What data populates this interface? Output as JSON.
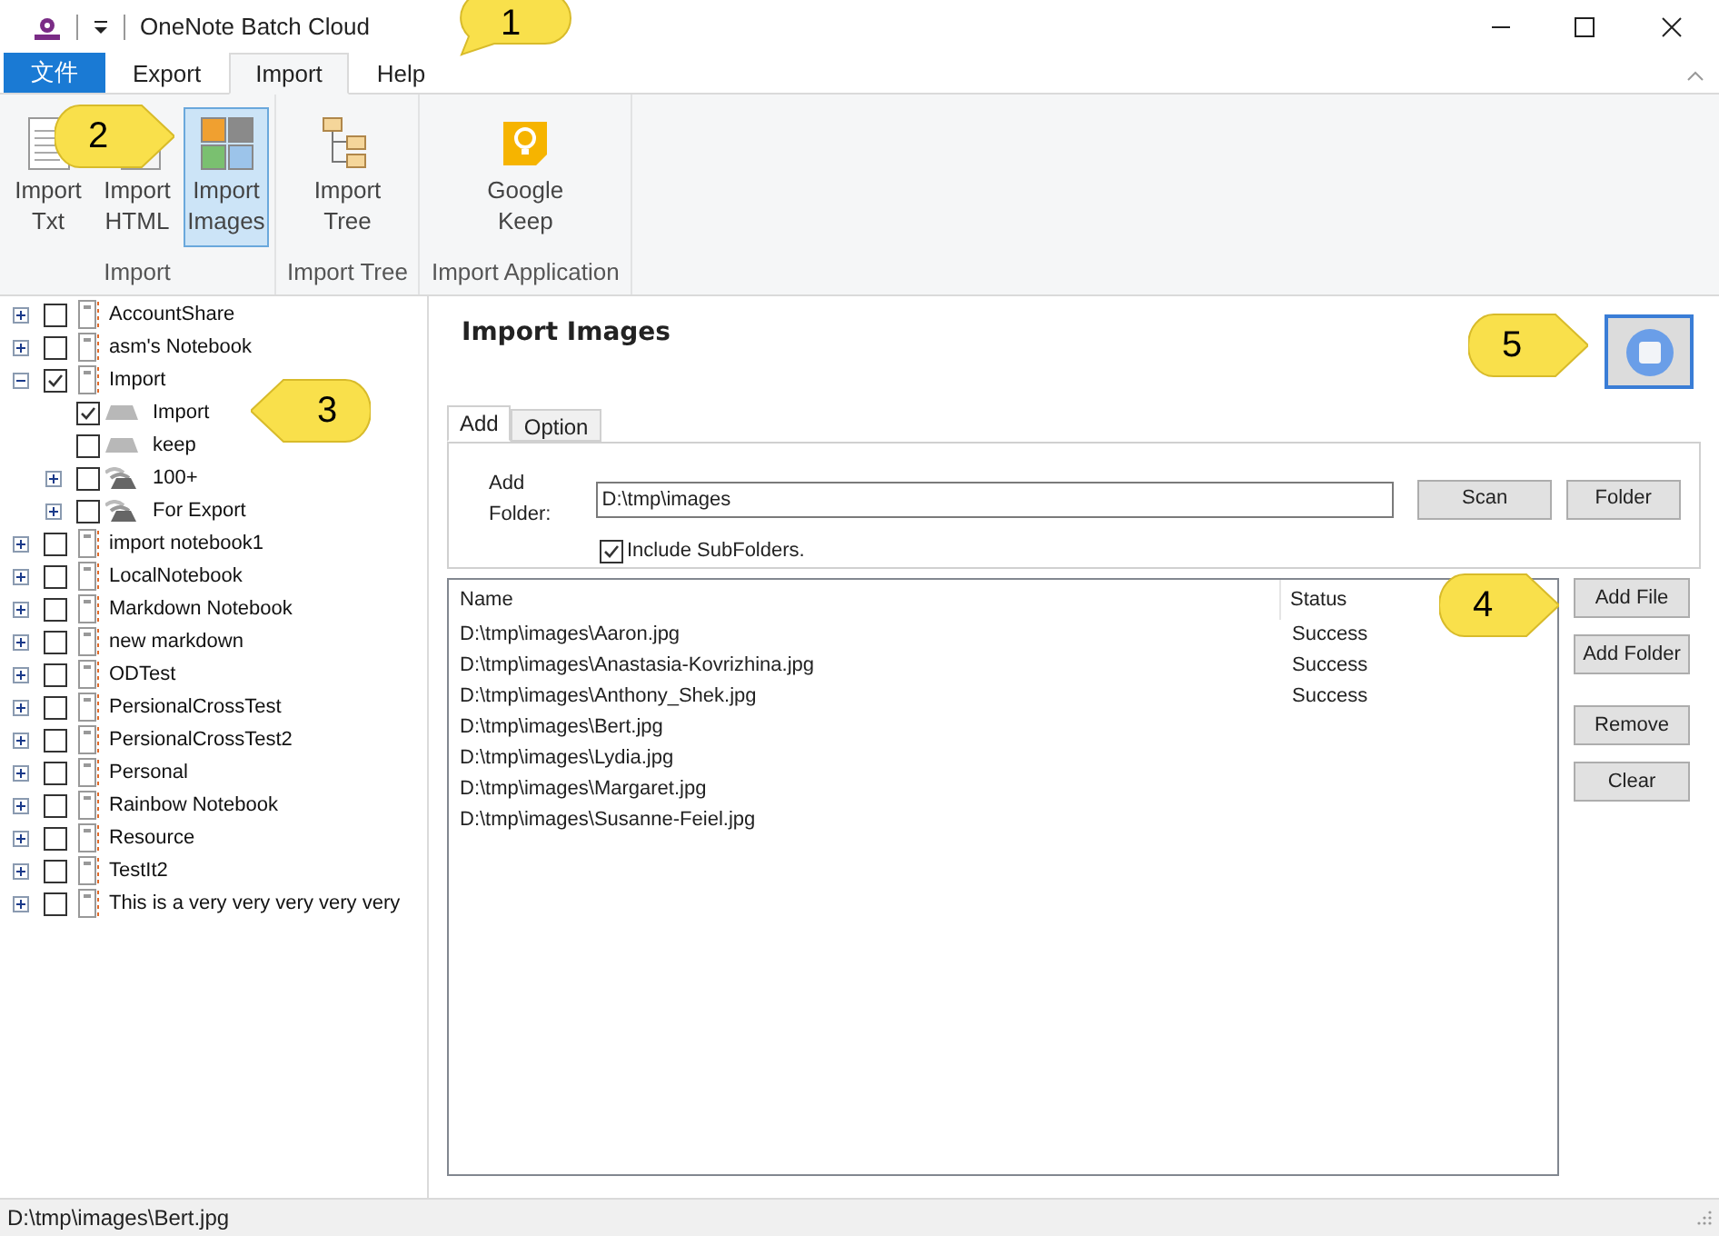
{
  "window": {
    "title": "OneNote Batch Cloud"
  },
  "menu_tabs": [
    {
      "label": "文件",
      "kind": "file",
      "selected": false
    },
    {
      "label": "Export",
      "kind": "tab",
      "selected": false
    },
    {
      "label": "Import",
      "kind": "tab",
      "selected": true
    },
    {
      "label": "Help",
      "kind": "tab",
      "selected": false
    }
  ],
  "ribbon_groups": [
    {
      "label": "Import",
      "buttons": [
        {
          "label": "Import Txt",
          "kind": "txt",
          "selected": false
        },
        {
          "label": "Import HTML",
          "kind": "html",
          "selected": false
        },
        {
          "label": "Import Images",
          "kind": "images",
          "selected": true
        }
      ]
    },
    {
      "label": "Import Tree",
      "buttons": [
        {
          "label": "Import Tree",
          "kind": "tree",
          "selected": false
        }
      ]
    },
    {
      "label": "Import Application",
      "buttons": [
        {
          "label": "Google Keep",
          "kind": "keep",
          "selected": false
        }
      ]
    }
  ],
  "tree": [
    {
      "label": "AccountShare",
      "kind": "notebook",
      "checked": false,
      "expanded": false
    },
    {
      "label": "asm's Notebook",
      "kind": "notebook",
      "checked": false,
      "expanded": false
    },
    {
      "label": "Import",
      "kind": "notebook",
      "checked": true,
      "expanded": true,
      "children": [
        {
          "label": "Import",
          "kind": "section",
          "checked": true
        },
        {
          "label": "keep",
          "kind": "section",
          "checked": false
        },
        {
          "label": "100+",
          "kind": "group",
          "checked": false,
          "expanded": false
        },
        {
          "label": "For Export",
          "kind": "group",
          "checked": false,
          "expanded": false
        }
      ]
    },
    {
      "label": "import notebook1",
      "kind": "notebook",
      "checked": false,
      "expanded": false
    },
    {
      "label": "LocalNotebook",
      "kind": "notebook",
      "checked": false,
      "expanded": false
    },
    {
      "label": "Markdown Notebook",
      "kind": "notebook",
      "checked": false,
      "expanded": false
    },
    {
      "label": "new markdown",
      "kind": "notebook",
      "checked": false,
      "expanded": false
    },
    {
      "label": "ODTest",
      "kind": "notebook",
      "checked": false,
      "expanded": false
    },
    {
      "label": "PersionalCrossTest",
      "kind": "notebook",
      "checked": false,
      "expanded": false
    },
    {
      "label": "PersionalCrossTest2",
      "kind": "notebook",
      "checked": false,
      "expanded": false
    },
    {
      "label": "Personal",
      "kind": "notebook",
      "checked": false,
      "expanded": false
    },
    {
      "label": "Rainbow Notebook",
      "kind": "notebook",
      "checked": false,
      "expanded": false
    },
    {
      "label": "Resource",
      "kind": "notebook",
      "checked": false,
      "expanded": false
    },
    {
      "label": "TestIt2",
      "kind": "notebook",
      "checked": false,
      "expanded": false
    },
    {
      "label": "This is a very very very very very",
      "kind": "notebook",
      "checked": false,
      "expanded": false
    }
  ],
  "panel": {
    "title": "Import Images",
    "tabs": [
      {
        "label": "Add",
        "selected": true
      },
      {
        "label": "Option",
        "selected": false
      }
    ],
    "folder_label": "Add Folder:",
    "folder_value": "D:\\tmp\\images",
    "folder_buttons": [
      "Scan",
      "Folder"
    ],
    "include_subfolders": {
      "label": "Include SubFolders.",
      "checked": true
    },
    "table": {
      "columns": [
        "Name",
        "Status"
      ],
      "rows": [
        {
          "name": "D:\\tmp\\images\\Aaron.jpg",
          "status": "Success"
        },
        {
          "name": "D:\\tmp\\images\\Anastasia-Kovrizhina.jpg",
          "status": "Success"
        },
        {
          "name": "D:\\tmp\\images\\Anthony_Shek.jpg",
          "status": "Success"
        },
        {
          "name": "D:\\tmp\\images\\Bert.jpg"
        },
        {
          "name": "D:\\tmp\\images\\Lydia.jpg"
        },
        {
          "name": "D:\\tmp\\images\\Margaret.jpg"
        },
        {
          "name": "D:\\tmp\\images\\Susanne-Feiel.jpg"
        }
      ]
    },
    "side_buttons": [
      "Add File",
      "Add Folder",
      "Remove",
      "Clear"
    ]
  },
  "status_bar": "D:\\tmp\\images\\Bert.jpg",
  "callouts": [
    {
      "label": "1",
      "kind": "down-left"
    },
    {
      "label": "2",
      "kind": "right"
    },
    {
      "label": "3",
      "kind": "left"
    },
    {
      "label": "4",
      "kind": "right"
    },
    {
      "label": "5",
      "kind": "right"
    }
  ]
}
